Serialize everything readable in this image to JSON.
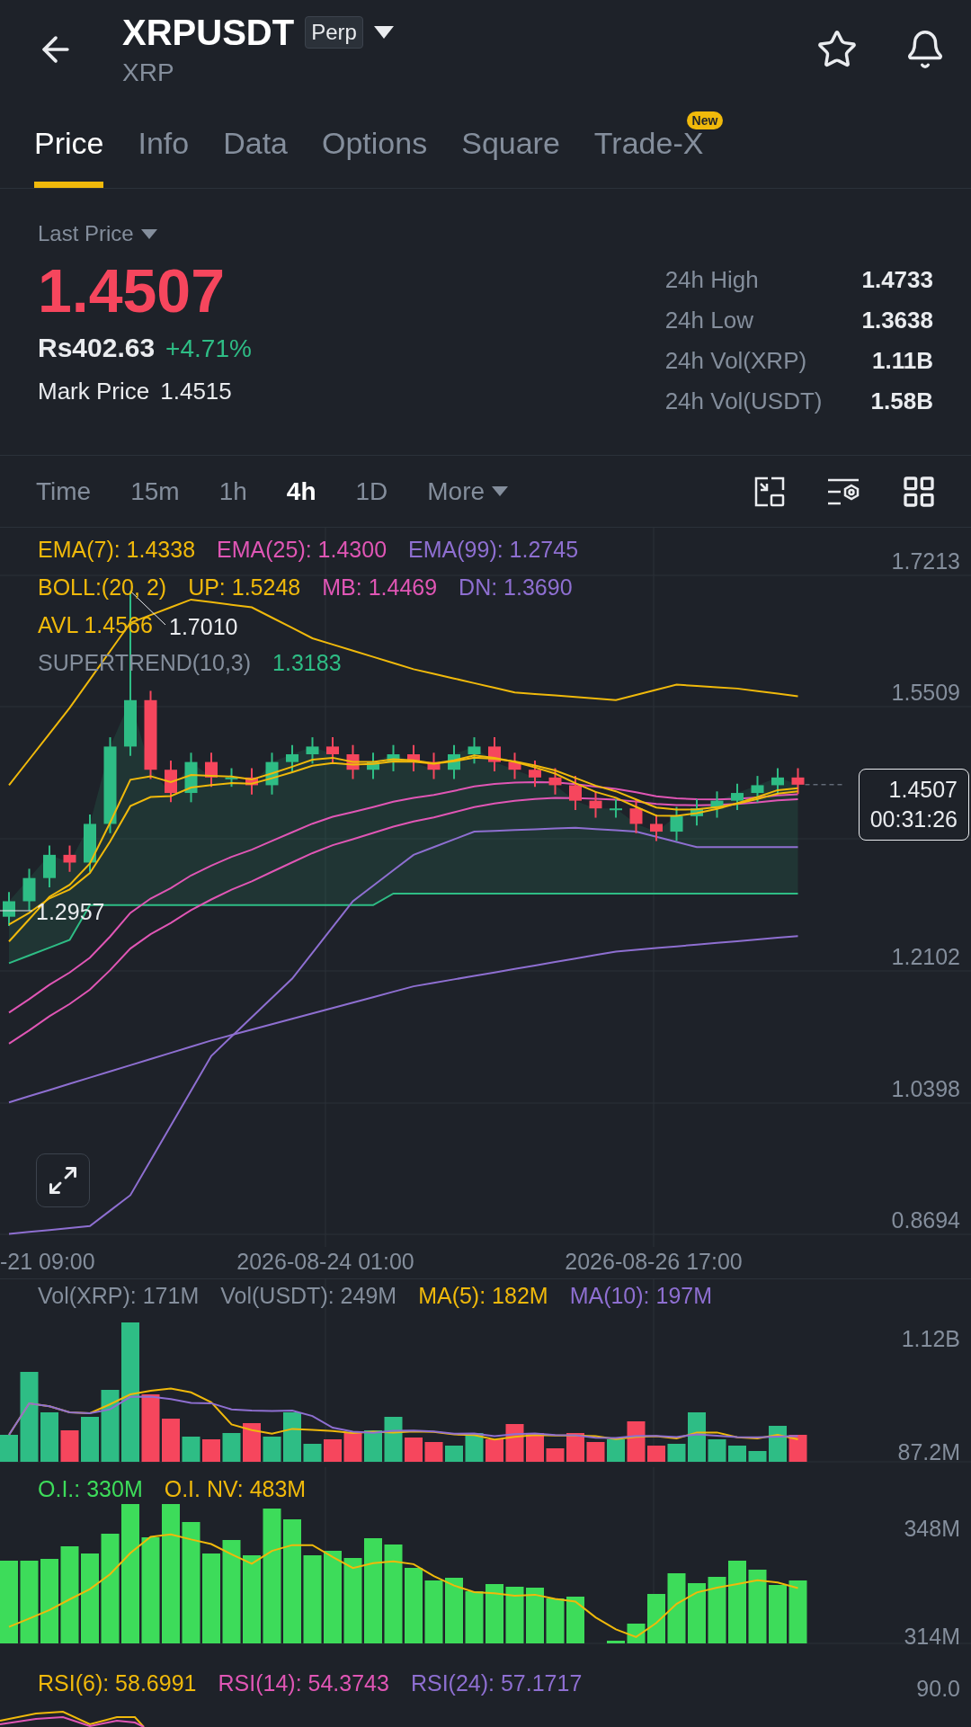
{
  "header": {
    "title": "XRPUSDT",
    "badge": "Perp",
    "subtitle": "XRP"
  },
  "tabs": [
    {
      "label": "Price",
      "selected": true
    },
    {
      "label": "Info",
      "selected": false
    },
    {
      "label": "Data",
      "selected": false
    },
    {
      "label": "Options",
      "selected": false
    },
    {
      "label": "Square",
      "selected": false
    },
    {
      "label": "Trade-X",
      "selected": false,
      "badge": "New"
    }
  ],
  "last_price": {
    "label": "Last Price",
    "value": "1.4507",
    "fiat": "Rs402.63",
    "change": "+4.71%",
    "mark_label": "Mark Price",
    "mark_value": "1.4515"
  },
  "stats": [
    {
      "label": "24h High",
      "value": "1.4733"
    },
    {
      "label": "24h Low",
      "value": "1.3638"
    },
    {
      "label": "24h Vol(XRP)",
      "value": "1.11B"
    },
    {
      "label": "24h Vol(USDT)",
      "value": "1.58B"
    }
  ],
  "intervals": [
    {
      "label": "Time",
      "selected": false
    },
    {
      "label": "15m",
      "selected": false
    },
    {
      "label": "1h",
      "selected": false
    },
    {
      "label": "4h",
      "selected": true
    },
    {
      "label": "1D",
      "selected": false
    }
  ],
  "more": "More",
  "chart": {
    "legend_rows": [
      [
        {
          "text": "EMA(7): 1.4338",
          "color": "#f0b90b"
        },
        {
          "text": "EMA(25): 1.4300",
          "color": "#e056b5"
        },
        {
          "text": "EMA(99): 1.2745",
          "color": "#8e6fd1"
        }
      ],
      [
        {
          "text": "BOLL:(20, 2)",
          "color": "#f0b90b"
        },
        {
          "text": "UP: 1.5248",
          "color": "#f0b90b"
        },
        {
          "text": "MB: 1.4469",
          "color": "#e056b5"
        },
        {
          "text": "DN: 1.3690",
          "color": "#8e6fd1"
        }
      ],
      [
        {
          "text": "AVL 1.4566",
          "color": "#f0b90b"
        }
      ],
      [
        {
          "text": "SUPERTREND(10,3)",
          "color": "#848e9c"
        },
        {
          "text": "1.3183",
          "color": "#2ebd85"
        }
      ]
    ],
    "y_ticks": [
      "1.7213",
      "1.5509",
      "1.2102",
      "1.0398",
      "0.8694"
    ],
    "high_label": "1.7010",
    "low_label": "1.2957",
    "price_tag": {
      "price": "1.4507",
      "countdown": "00:31:26"
    },
    "x_labels": [
      "-21 09:00",
      "2026-08-24 01:00",
      "2026-08-26 17:00"
    ]
  },
  "volume": {
    "legends": [
      {
        "text": "Vol(XRP): 171M",
        "color": "#848e9c"
      },
      {
        "text": "Vol(USDT): 249M",
        "color": "#848e9c"
      },
      {
        "text": "MA(5): 182M",
        "color": "#f0b90b"
      },
      {
        "text": "MA(10): 197M",
        "color": "#8e6fd1"
      }
    ],
    "y_ticks": [
      "1.12B",
      "87.2M"
    ]
  },
  "open_interest": {
    "legends": [
      {
        "text": "O.I.: 330M",
        "color": "#3ddc5a"
      },
      {
        "text": "O.I. NV: 483M",
        "color": "#f0b90b"
      }
    ],
    "y_ticks": [
      "348M",
      "314M"
    ]
  },
  "rsi": {
    "legends": [
      {
        "text": "RSI(6): 58.6991",
        "color": "#f0b90b"
      },
      {
        "text": "RSI(14): 54.3743",
        "color": "#e056b5"
      },
      {
        "text": "RSI(24): 57.1717",
        "color": "#8e6fd1"
      }
    ],
    "y_ticks": [
      "90.0"
    ]
  }
}
